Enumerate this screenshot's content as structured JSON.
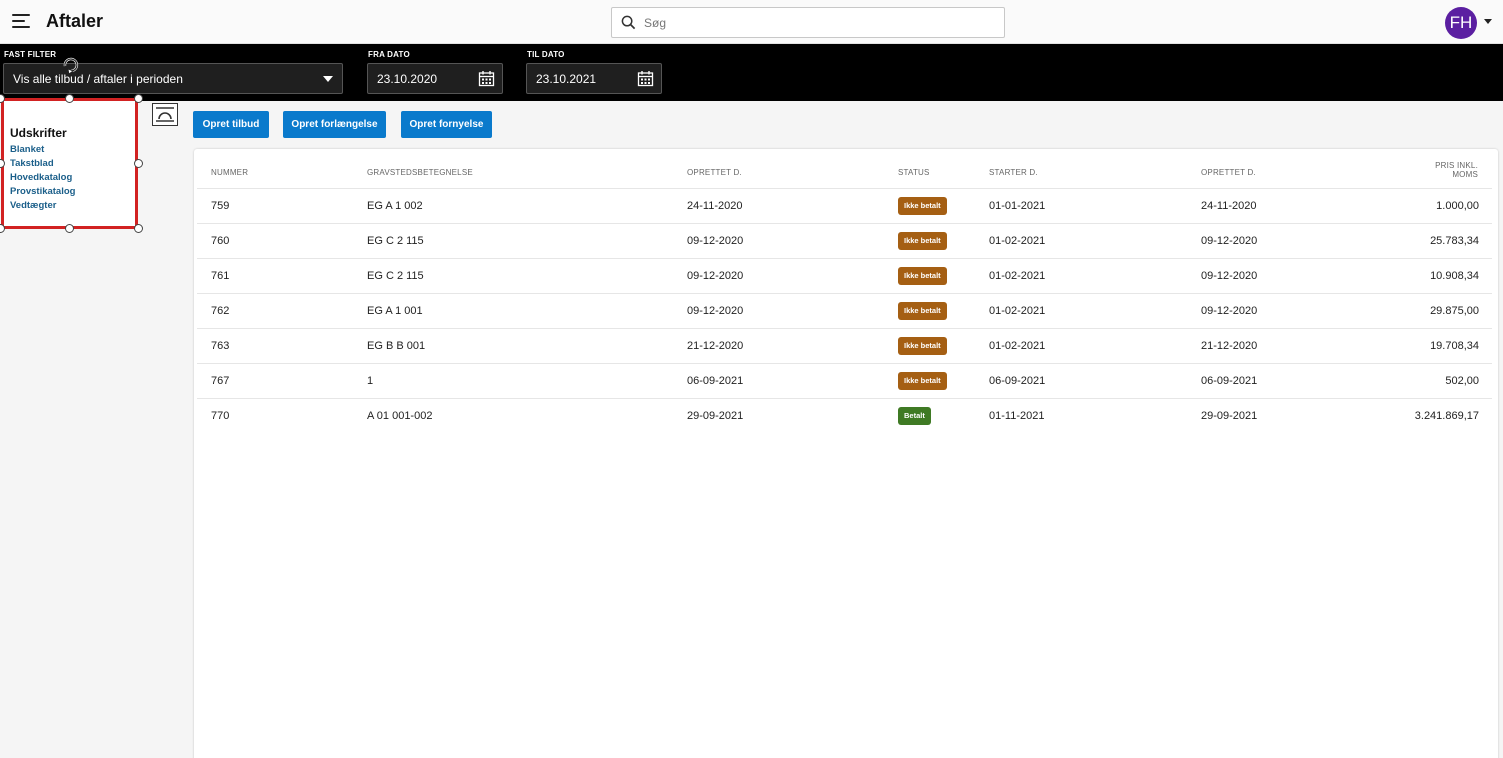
{
  "header": {
    "title": "Aftaler",
    "search_placeholder": "Søg",
    "avatar_initials": "FH",
    "avatar_color": "#5b1fa1"
  },
  "filters": {
    "fast_filter_label": "FAST FILTER",
    "fast_filter_value": "Vis alle tilbud / aftaler i perioden",
    "fra_dato_label": "FRA DATO",
    "fra_dato_value": "23.10.2020",
    "til_dato_label": "TIL DATO",
    "til_dato_value": "23.10.2021"
  },
  "print_panel": {
    "title": "Udskrifter",
    "links": [
      "Blanket",
      "Takstblad",
      "Hovedkatalog",
      "Provstikatalog",
      "Vedtægter"
    ]
  },
  "actions": {
    "opret_tilbud": "Opret tilbud",
    "opret_forlaengelse": "Opret forlængelse",
    "opret_fornyelse": "Opret fornyelse",
    "button_color": "#0a7acc"
  },
  "table": {
    "headers": {
      "nummer": "NUMMER",
      "gravsted": "GRAVSTEDSBETEGNELSE",
      "oprettet1": "OPRETTET D.",
      "status": "STATUS",
      "starter": "STARTER D.",
      "oprettet2": "OPRETTET D.",
      "pris_line1": "PRIS INKL.",
      "pris_line2": "MOMS"
    },
    "status_colors": {
      "Ikke betalt": "#a55f13",
      "Betalt": "#3f7a24"
    },
    "rows": [
      {
        "nummer": "759",
        "gravsted": "EG A 1 002",
        "oprettet": "24-11-2020",
        "status": "Ikke betalt",
        "starter": "01-01-2021",
        "oprettet2": "24-11-2020",
        "pris": "1.000,00"
      },
      {
        "nummer": "760",
        "gravsted": "EG C 2 115",
        "oprettet": "09-12-2020",
        "status": "Ikke betalt",
        "starter": "01-02-2021",
        "oprettet2": "09-12-2020",
        "pris": "25.783,34"
      },
      {
        "nummer": "761",
        "gravsted": "EG C 2 115",
        "oprettet": "09-12-2020",
        "status": "Ikke betalt",
        "starter": "01-02-2021",
        "oprettet2": "09-12-2020",
        "pris": "10.908,34"
      },
      {
        "nummer": "762",
        "gravsted": "EG A 1 001",
        "oprettet": "09-12-2020",
        "status": "Ikke betalt",
        "starter": "01-02-2021",
        "oprettet2": "09-12-2020",
        "pris": "29.875,00"
      },
      {
        "nummer": "763",
        "gravsted": "EG B B 001",
        "oprettet": "21-12-2020",
        "status": "Ikke betalt",
        "starter": "01-02-2021",
        "oprettet2": "21-12-2020",
        "pris": "19.708,34"
      },
      {
        "nummer": "767",
        "gravsted": "1",
        "oprettet": "06-09-2021",
        "status": "Ikke betalt",
        "starter": "06-09-2021",
        "oprettet2": "06-09-2021",
        "pris": "502,00"
      },
      {
        "nummer": "770",
        "gravsted": "A 01 001-002",
        "oprettet": "29-09-2021",
        "status": "Betalt",
        "starter": "01-11-2021",
        "oprettet2": "29-09-2021",
        "pris": "3.241.869,17"
      }
    ]
  }
}
